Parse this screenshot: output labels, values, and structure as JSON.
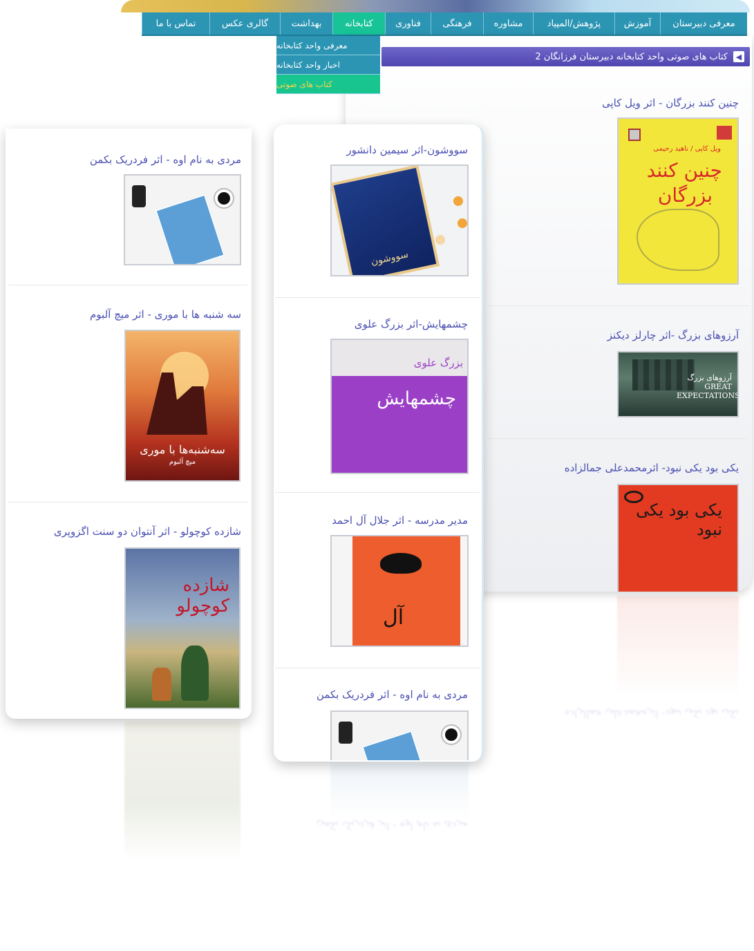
{
  "nav": {
    "items": [
      {
        "label": "معرفی دبیرستان",
        "active": false
      },
      {
        "label": "آموزش",
        "active": false
      },
      {
        "label": "پژوهش/المپیاد",
        "active": false
      },
      {
        "label": "مشاوره",
        "active": false
      },
      {
        "label": "فرهنگی",
        "active": false
      },
      {
        "label": "فناوری",
        "active": false
      },
      {
        "label": "کتابخانه",
        "active": true
      },
      {
        "label": "بهداشت",
        "active": false
      },
      {
        "label": "گالری عکس",
        "active": false
      },
      {
        "label": "تماس با ما",
        "active": false
      }
    ]
  },
  "dropdown": {
    "items": [
      {
        "label": "معرفی واحد کتابخانه",
        "active": false
      },
      {
        "label": "اخبار واحد کتابخانه",
        "active": false
      },
      {
        "label": "کتاب های صوتی",
        "active": true
      }
    ]
  },
  "page_header": {
    "title": "کتاب های صوتی واحد کتابخانه دبیرستان فرزانگان 2"
  },
  "books_right": [
    {
      "title": "چنین کنند بزرگان - اثر ویل کاپی",
      "cover_text": "چنین کنند",
      "cover_text2": "بزرگان",
      "cover_sub": "ویل کاپی / ناهید رحیمی"
    },
    {
      "title": "آرزوهای بزرگ -اثر چارلز دیکنز",
      "cover_text": "آرزوهای بزرگ GREAT EXPECTATIONS"
    },
    {
      "title": "یکی بود یکی نبود- اثرمحمدعلی جمالزاده",
      "cover_text": "یکی بود یکی نبود"
    }
  ],
  "books_middle": [
    {
      "title": "سووشون-اثر سیمین دانشور",
      "cover_text": "سووشون"
    },
    {
      "title": "چشمهایش-اثر بزرگ علوی",
      "cover_author": "بزرگ علوی",
      "cover_text": "چشمهایش"
    },
    {
      "title": "مدیر مدرسه - اثر جلال آل احمد",
      "cover_text": "آل"
    },
    {
      "title": "مردی به نام اوه - اثر فردریک بکمن"
    }
  ],
  "books_left": [
    {
      "title": "مردی به نام اوه - اثر فردریک بکمن"
    },
    {
      "title": "سه شنبه ها با موری - اثر میچ آلبوم",
      "cover_text": "سه‌شنبه‌ها با موری",
      "cover_author": "میچ آلبوم"
    },
    {
      "title": "شازده کوچولو - اثر آنتوان دو سنت اگزوپری",
      "cover_text": "شازده کوچولو"
    }
  ],
  "reflection": {
    "mid_title": "مردی به نام اوه - اثر فردریک بکمن",
    "right_title": "یکی بود یکی نبود- اثرمحمدعلی جمالزاده"
  },
  "colors": {
    "nav": "#2b95b3",
    "nav_active": "#18c497",
    "header": "#5148b3",
    "title_text": "#4a4fb2"
  }
}
